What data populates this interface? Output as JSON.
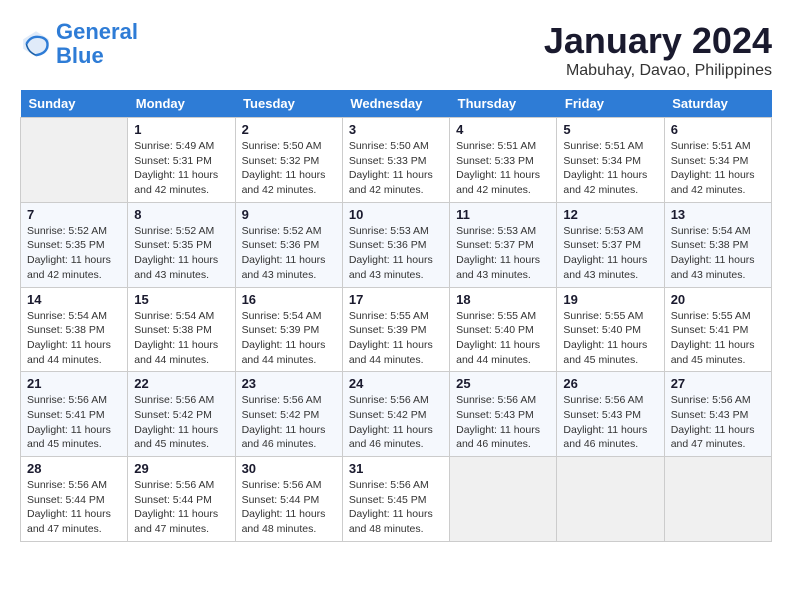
{
  "header": {
    "logo_line1": "General",
    "logo_line2": "Blue",
    "month_title": "January 2024",
    "subtitle": "Mabuhay, Davao, Philippines"
  },
  "weekdays": [
    "Sunday",
    "Monday",
    "Tuesday",
    "Wednesday",
    "Thursday",
    "Friday",
    "Saturday"
  ],
  "weeks": [
    [
      {
        "day": "",
        "info": ""
      },
      {
        "day": "1",
        "info": "Sunrise: 5:49 AM\nSunset: 5:31 PM\nDaylight: 11 hours\nand 42 minutes."
      },
      {
        "day": "2",
        "info": "Sunrise: 5:50 AM\nSunset: 5:32 PM\nDaylight: 11 hours\nand 42 minutes."
      },
      {
        "day": "3",
        "info": "Sunrise: 5:50 AM\nSunset: 5:33 PM\nDaylight: 11 hours\nand 42 minutes."
      },
      {
        "day": "4",
        "info": "Sunrise: 5:51 AM\nSunset: 5:33 PM\nDaylight: 11 hours\nand 42 minutes."
      },
      {
        "day": "5",
        "info": "Sunrise: 5:51 AM\nSunset: 5:34 PM\nDaylight: 11 hours\nand 42 minutes."
      },
      {
        "day": "6",
        "info": "Sunrise: 5:51 AM\nSunset: 5:34 PM\nDaylight: 11 hours\nand 42 minutes."
      }
    ],
    [
      {
        "day": "7",
        "info": "Sunrise: 5:52 AM\nSunset: 5:35 PM\nDaylight: 11 hours\nand 42 minutes."
      },
      {
        "day": "8",
        "info": "Sunrise: 5:52 AM\nSunset: 5:35 PM\nDaylight: 11 hours\nand 43 minutes."
      },
      {
        "day": "9",
        "info": "Sunrise: 5:52 AM\nSunset: 5:36 PM\nDaylight: 11 hours\nand 43 minutes."
      },
      {
        "day": "10",
        "info": "Sunrise: 5:53 AM\nSunset: 5:36 PM\nDaylight: 11 hours\nand 43 minutes."
      },
      {
        "day": "11",
        "info": "Sunrise: 5:53 AM\nSunset: 5:37 PM\nDaylight: 11 hours\nand 43 minutes."
      },
      {
        "day": "12",
        "info": "Sunrise: 5:53 AM\nSunset: 5:37 PM\nDaylight: 11 hours\nand 43 minutes."
      },
      {
        "day": "13",
        "info": "Sunrise: 5:54 AM\nSunset: 5:38 PM\nDaylight: 11 hours\nand 43 minutes."
      }
    ],
    [
      {
        "day": "14",
        "info": "Sunrise: 5:54 AM\nSunset: 5:38 PM\nDaylight: 11 hours\nand 44 minutes."
      },
      {
        "day": "15",
        "info": "Sunrise: 5:54 AM\nSunset: 5:38 PM\nDaylight: 11 hours\nand 44 minutes."
      },
      {
        "day": "16",
        "info": "Sunrise: 5:54 AM\nSunset: 5:39 PM\nDaylight: 11 hours\nand 44 minutes."
      },
      {
        "day": "17",
        "info": "Sunrise: 5:55 AM\nSunset: 5:39 PM\nDaylight: 11 hours\nand 44 minutes."
      },
      {
        "day": "18",
        "info": "Sunrise: 5:55 AM\nSunset: 5:40 PM\nDaylight: 11 hours\nand 44 minutes."
      },
      {
        "day": "19",
        "info": "Sunrise: 5:55 AM\nSunset: 5:40 PM\nDaylight: 11 hours\nand 45 minutes."
      },
      {
        "day": "20",
        "info": "Sunrise: 5:55 AM\nSunset: 5:41 PM\nDaylight: 11 hours\nand 45 minutes."
      }
    ],
    [
      {
        "day": "21",
        "info": "Sunrise: 5:56 AM\nSunset: 5:41 PM\nDaylight: 11 hours\nand 45 minutes."
      },
      {
        "day": "22",
        "info": "Sunrise: 5:56 AM\nSunset: 5:42 PM\nDaylight: 11 hours\nand 45 minutes."
      },
      {
        "day": "23",
        "info": "Sunrise: 5:56 AM\nSunset: 5:42 PM\nDaylight: 11 hours\nand 46 minutes."
      },
      {
        "day": "24",
        "info": "Sunrise: 5:56 AM\nSunset: 5:42 PM\nDaylight: 11 hours\nand 46 minutes."
      },
      {
        "day": "25",
        "info": "Sunrise: 5:56 AM\nSunset: 5:43 PM\nDaylight: 11 hours\nand 46 minutes."
      },
      {
        "day": "26",
        "info": "Sunrise: 5:56 AM\nSunset: 5:43 PM\nDaylight: 11 hours\nand 46 minutes."
      },
      {
        "day": "27",
        "info": "Sunrise: 5:56 AM\nSunset: 5:43 PM\nDaylight: 11 hours\nand 47 minutes."
      }
    ],
    [
      {
        "day": "28",
        "info": "Sunrise: 5:56 AM\nSunset: 5:44 PM\nDaylight: 11 hours\nand 47 minutes."
      },
      {
        "day": "29",
        "info": "Sunrise: 5:56 AM\nSunset: 5:44 PM\nDaylight: 11 hours\nand 47 minutes."
      },
      {
        "day": "30",
        "info": "Sunrise: 5:56 AM\nSunset: 5:44 PM\nDaylight: 11 hours\nand 48 minutes."
      },
      {
        "day": "31",
        "info": "Sunrise: 5:56 AM\nSunset: 5:45 PM\nDaylight: 11 hours\nand 48 minutes."
      },
      {
        "day": "",
        "info": ""
      },
      {
        "day": "",
        "info": ""
      },
      {
        "day": "",
        "info": ""
      }
    ]
  ]
}
